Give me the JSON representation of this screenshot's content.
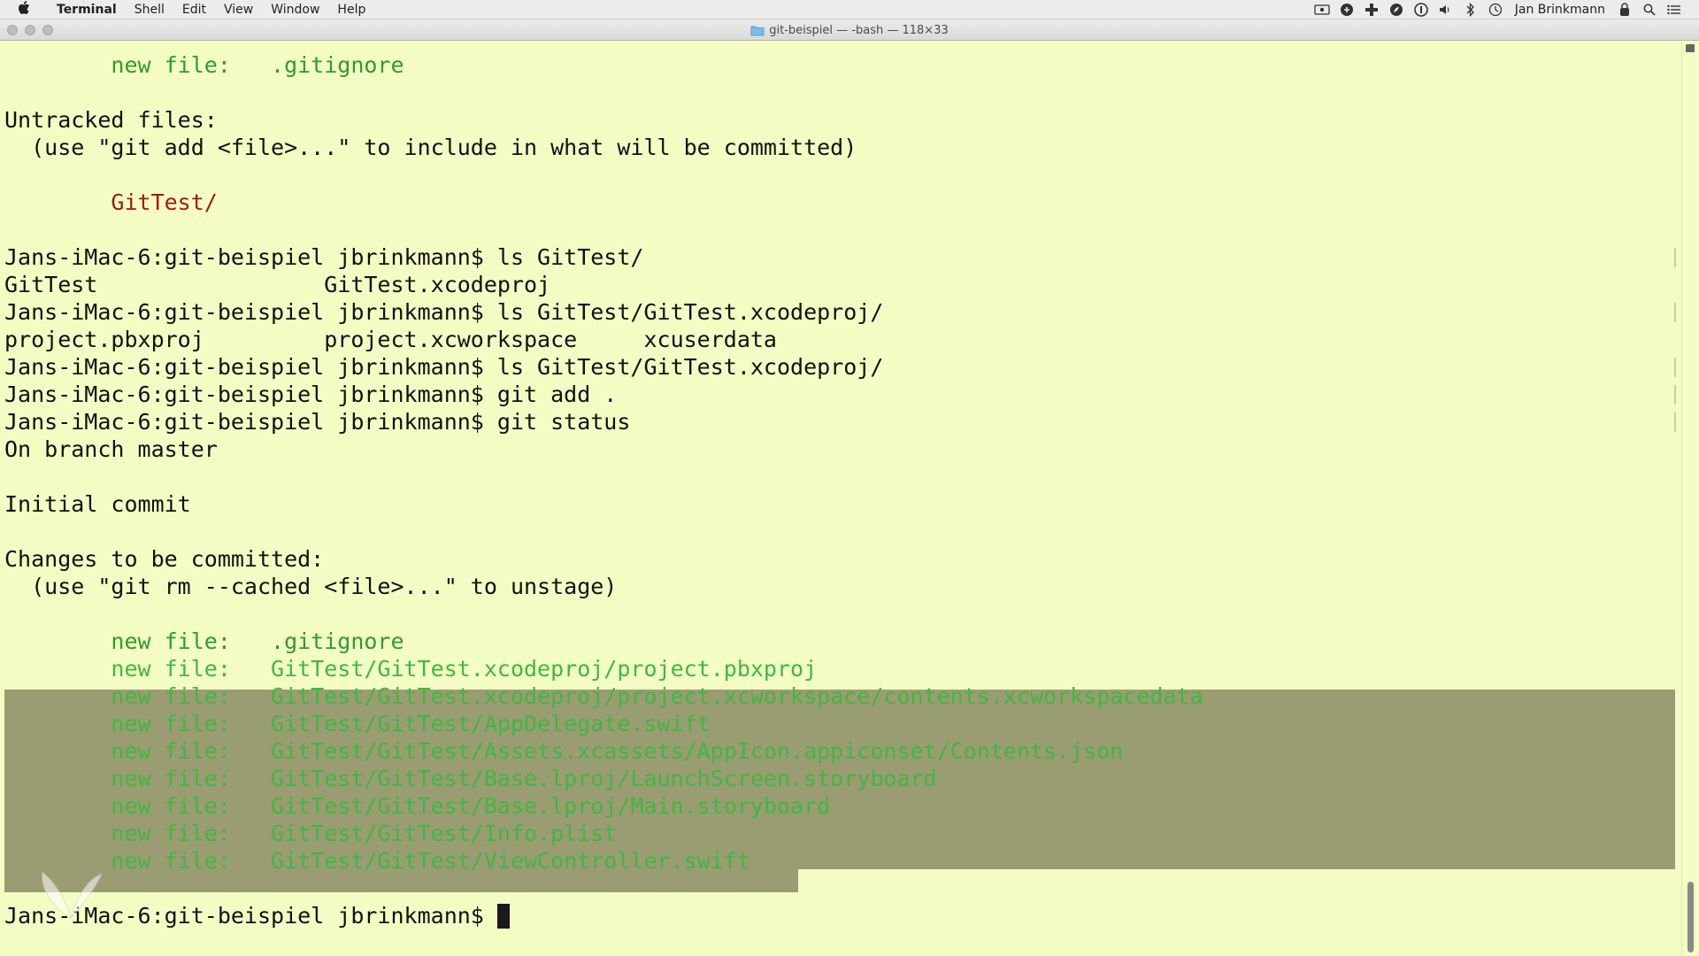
{
  "menubar": {
    "app_name": "Terminal",
    "items": [
      "Shell",
      "Edit",
      "View",
      "Window",
      "Help"
    ],
    "user_name": "Jan Brinkmann"
  },
  "window": {
    "title": "git-beispiel — -bash — 118×33"
  },
  "terminal": {
    "lines": [
      {
        "text": "        new file:   .gitignore",
        "style": "green"
      },
      {
        "text": "",
        "style": "plain"
      },
      {
        "text": "Untracked files:",
        "style": "plain"
      },
      {
        "text": "  (use \"git add <file>...\" to include in what will be committed)",
        "style": "plain"
      },
      {
        "text": "",
        "style": "plain"
      },
      {
        "text": "        GitTest/",
        "style": "red"
      },
      {
        "text": "",
        "style": "plain"
      },
      {
        "text": "Jans-iMac-6:git-beispiel jbrinkmann$ ls GitTest/",
        "style": "plain"
      },
      {
        "text": "GitTest                 GitTest.xcodeproj",
        "style": "plain"
      },
      {
        "text": "Jans-iMac-6:git-beispiel jbrinkmann$ ls GitTest/GitTest.xcodeproj/",
        "style": "plain"
      },
      {
        "text": "project.pbxproj         project.xcworkspace     xcuserdata",
        "style": "plain"
      },
      {
        "text": "Jans-iMac-6:git-beispiel jbrinkmann$ ls GitTest/GitTest.xcodeproj/",
        "style": "plain"
      },
      {
        "text": "Jans-iMac-6:git-beispiel jbrinkmann$ git add .",
        "style": "plain"
      },
      {
        "text": "Jans-iMac-6:git-beispiel jbrinkmann$ git status",
        "style": "plain"
      },
      {
        "text": "On branch master",
        "style": "plain"
      },
      {
        "text": "",
        "style": "plain"
      },
      {
        "text": "Initial commit",
        "style": "plain"
      },
      {
        "text": "",
        "style": "plain"
      },
      {
        "text": "Changes to be committed:",
        "style": "plain"
      },
      {
        "text": "  (use \"git rm --cached <file>...\" to unstage)",
        "style": "plain"
      },
      {
        "text": "",
        "style": "plain"
      },
      {
        "text": "        new file:   .gitignore",
        "style": "green"
      },
      {
        "text": "        new file:   GitTest/GitTest.xcodeproj/project.pbxproj",
        "style": "selected"
      },
      {
        "text": "        new file:   GitTest/GitTest.xcodeproj/project.xcworkspace/contents.xcworkspacedata",
        "style": "selected"
      },
      {
        "text": "        new file:   GitTest/GitTest/AppDelegate.swift",
        "style": "selected"
      },
      {
        "text": "        new file:   GitTest/GitTest/Assets.xcassets/AppIcon.appiconset/Contents.json",
        "style": "selected"
      },
      {
        "text": "        new file:   GitTest/GitTest/Base.lproj/LaunchScreen.storyboard",
        "style": "selected"
      },
      {
        "text": "        new file:   GitTest/GitTest/Base.lproj/Main.storyboard",
        "style": "selected"
      },
      {
        "text": "        new file:   GitTest/GitTest/Info.plist",
        "style": "selected"
      },
      {
        "text": "        new file:   GitTest/GitTest/ViewController.swift",
        "style": "selected"
      },
      {
        "text": "",
        "style": "plain"
      },
      {
        "text": "Jans-iMac-6:git-beispiel jbrinkmann$ ",
        "style": "prompt"
      }
    ]
  },
  "colors": {
    "background": "#f3fcc3",
    "green_text": "#2f9c2f",
    "red_text": "#a01a1a",
    "selection": "#9a9c72"
  }
}
